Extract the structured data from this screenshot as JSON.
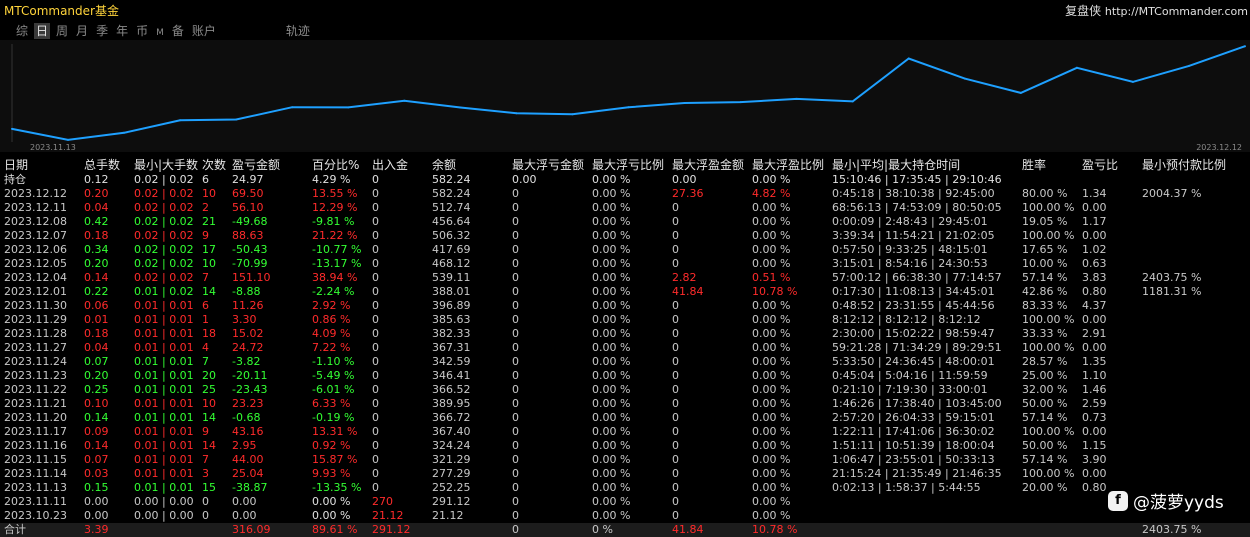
{
  "header": {
    "brand": "MTCommander",
    "brand_suffix": "基金",
    "top_label": "复盘侠",
    "url": "http://MTCommander.com"
  },
  "tabs": [
    "综",
    "日",
    "周",
    "月",
    "季",
    "年",
    "币",
    "M",
    "备",
    "账户",
    "轨迹"
  ],
  "active_tab": "日",
  "chart_data": {
    "type": "line",
    "x_start_label": "2023.11.13",
    "x_end_label": "2023.12.12",
    "x": [
      "2023.11.11",
      "2023.11.13",
      "2023.11.14",
      "2023.11.15",
      "2023.11.16",
      "2023.11.17",
      "2023.11.20",
      "2023.11.21",
      "2023.11.22",
      "2023.11.23",
      "2023.11.24",
      "2023.11.27",
      "2023.11.28",
      "2023.11.29",
      "2023.11.30",
      "2023.12.01",
      "2023.12.04",
      "2023.12.05",
      "2023.12.06",
      "2023.12.07",
      "2023.12.08",
      "2023.12.11",
      "2023.12.12"
    ],
    "values": [
      291.12,
      252.25,
      277.29,
      321.29,
      324.24,
      367.4,
      366.72,
      389.95,
      366.52,
      346.41,
      342.59,
      367.31,
      382.33,
      385.63,
      396.89,
      388.01,
      539.11,
      468.12,
      417.69,
      506.32,
      456.64,
      512.74,
      582.24
    ],
    "ylim": [
      245,
      590
    ],
    "color": "#1ea0ff"
  },
  "table": {
    "headers": [
      "日期",
      "总手数",
      "最小|大手数",
      "次数",
      "盈亏金额",
      "百分比%",
      "出入金",
      "余额",
      "最大浮亏金额",
      "最大浮亏比例",
      "最大浮盈金额",
      "最大浮盈比例",
      "最小|平均|最大持仓时间",
      "胜率",
      "盈亏比",
      "最小预付款比例"
    ],
    "hold": [
      "持仓",
      "0.12",
      "0.02 | 0.02",
      "6",
      "24.97",
      "4.29 %",
      "0",
      "582.24",
      "0.00",
      "0.00 %",
      "0.00",
      "0.00 %",
      "15:10:46 | 17:35:45 | 29:10:46",
      "",
      "",
      ""
    ],
    "rows": [
      {
        "c": "r",
        "v": [
          "2023.12.12",
          "0.20",
          "0.02 | 0.02",
          "10",
          "69.50",
          "13.55 %",
          "0",
          "582.24",
          "0",
          "0.00 %",
          "27.36",
          "4.82 %",
          "0:45:18 | 38:10:38 | 92:45:00",
          "80.00 %",
          "1.34",
          "2004.37 %"
        ]
      },
      {
        "c": "r",
        "v": [
          "2023.12.11",
          "0.04",
          "0.02 | 0.02",
          "2",
          "56.10",
          "12.29 %",
          "0",
          "512.74",
          "0",
          "0.00 %",
          "0",
          "0.00 %",
          "68:56:13 | 74:53:09 | 80:50:05",
          "100.00 %",
          "0.00",
          ""
        ]
      },
      {
        "c": "g",
        "v": [
          "2023.12.08",
          "0.42",
          "0.02 | 0.02",
          "21",
          "-49.68",
          "-9.81 %",
          "0",
          "456.64",
          "0",
          "0.00 %",
          "0",
          "0.00 %",
          "0:00:09 | 2:48:43 | 29:45:01",
          "19.05 %",
          "1.17",
          ""
        ]
      },
      {
        "c": "r",
        "v": [
          "2023.12.07",
          "0.18",
          "0.02 | 0.02",
          "9",
          "88.63",
          "21.22 %",
          "0",
          "506.32",
          "0",
          "0.00 %",
          "0",
          "0.00 %",
          "3:39:34 | 11:54:21 | 21:02:05",
          "100.00 %",
          "0.00",
          ""
        ]
      },
      {
        "c": "g",
        "v": [
          "2023.12.06",
          "0.34",
          "0.02 | 0.02",
          "17",
          "-50.43",
          "-10.77 %",
          "0",
          "417.69",
          "0",
          "0.00 %",
          "0",
          "0.00 %",
          "0:57:50 | 9:33:25 | 48:15:01",
          "17.65 %",
          "1.02",
          ""
        ]
      },
      {
        "c": "g",
        "v": [
          "2023.12.05",
          "0.20",
          "0.02 | 0.02",
          "10",
          "-70.99",
          "-13.17 %",
          "0",
          "468.12",
          "0",
          "0.00 %",
          "0",
          "0.00 %",
          "3:15:01 | 8:54:16 | 24:30:53",
          "10.00 %",
          "0.63",
          ""
        ]
      },
      {
        "c": "r",
        "v": [
          "2023.12.04",
          "0.14",
          "0.02 | 0.02",
          "7",
          "151.10",
          "38.94 %",
          "0",
          "539.11",
          "0",
          "0.00 %",
          "2.82",
          "0.51 %",
          "57:00:12 | 66:38:30 | 77:14:57",
          "57.14 %",
          "3.83",
          "2403.75 %"
        ]
      },
      {
        "c": "g",
        "v": [
          "2023.12.01",
          "0.22",
          "0.01 | 0.02",
          "14",
          "-8.88",
          "-2.24 %",
          "0",
          "388.01",
          "0",
          "0.00 %",
          "41.84",
          "10.78 %",
          "0:17:30 | 11:08:13 | 34:45:01",
          "42.86 %",
          "0.80",
          "1181.31 %"
        ]
      },
      {
        "c": "r",
        "v": [
          "2023.11.30",
          "0.06",
          "0.01 | 0.01",
          "6",
          "11.26",
          "2.92 %",
          "0",
          "396.89",
          "0",
          "0.00 %",
          "0",
          "0.00 %",
          "0:48:52 | 23:31:55 | 45:44:56",
          "83.33 %",
          "4.37",
          ""
        ]
      },
      {
        "c": "r",
        "v": [
          "2023.11.29",
          "0.01",
          "0.01 | 0.01",
          "1",
          "3.30",
          "0.86 %",
          "0",
          "385.63",
          "0",
          "0.00 %",
          "0",
          "0.00 %",
          "8:12:12 | 8:12:12 | 8:12:12",
          "100.00 %",
          "0.00",
          ""
        ]
      },
      {
        "c": "r",
        "v": [
          "2023.11.28",
          "0.18",
          "0.01 | 0.01",
          "18",
          "15.02",
          "4.09 %",
          "0",
          "382.33",
          "0",
          "0.00 %",
          "0",
          "0.00 %",
          "2:30:00 | 15:02:22 | 98:59:47",
          "33.33 %",
          "2.91",
          ""
        ]
      },
      {
        "c": "r",
        "v": [
          "2023.11.27",
          "0.04",
          "0.01 | 0.01",
          "4",
          "24.72",
          "7.22 %",
          "0",
          "367.31",
          "0",
          "0.00 %",
          "0",
          "0.00 %",
          "59:21:28 | 71:34:29 | 89:29:51",
          "100.00 %",
          "0.00",
          ""
        ]
      },
      {
        "c": "g",
        "v": [
          "2023.11.24",
          "0.07",
          "0.01 | 0.01",
          "7",
          "-3.82",
          "-1.10 %",
          "0",
          "342.59",
          "0",
          "0.00 %",
          "0",
          "0.00 %",
          "5:33:50 | 24:36:45 | 48:00:01",
          "28.57 %",
          "1.35",
          ""
        ]
      },
      {
        "c": "g",
        "v": [
          "2023.11.23",
          "0.20",
          "0.01 | 0.01",
          "20",
          "-20.11",
          "-5.49 %",
          "0",
          "346.41",
          "0",
          "0.00 %",
          "0",
          "0.00 %",
          "0:45:04 | 5:04:16 | 11:59:59",
          "25.00 %",
          "1.10",
          ""
        ]
      },
      {
        "c": "g",
        "v": [
          "2023.11.22",
          "0.25",
          "0.01 | 0.01",
          "25",
          "-23.43",
          "-6.01 %",
          "0",
          "366.52",
          "0",
          "0.00 %",
          "0",
          "0.00 %",
          "0:21:10 | 7:19:30 | 33:00:01",
          "32.00 %",
          "1.46",
          ""
        ]
      },
      {
        "c": "r",
        "v": [
          "2023.11.21",
          "0.10",
          "0.01 | 0.01",
          "10",
          "23.23",
          "6.33 %",
          "0",
          "389.95",
          "0",
          "0.00 %",
          "0",
          "0.00 %",
          "1:46:26 | 17:38:40 | 103:45:00",
          "50.00 %",
          "2.59",
          ""
        ]
      },
      {
        "c": "g",
        "v": [
          "2023.11.20",
          "0.14",
          "0.01 | 0.01",
          "14",
          "-0.68",
          "-0.19 %",
          "0",
          "366.72",
          "0",
          "0.00 %",
          "0",
          "0.00 %",
          "2:57:20 | 26:04:33 | 59:15:01",
          "57.14 %",
          "0.73",
          ""
        ]
      },
      {
        "c": "r",
        "v": [
          "2023.11.17",
          "0.09",
          "0.01 | 0.01",
          "9",
          "43.16",
          "13.31 %",
          "0",
          "367.40",
          "0",
          "0.00 %",
          "0",
          "0.00 %",
          "1:22:11 | 17:41:06 | 36:30:02",
          "100.00 %",
          "0.00",
          ""
        ]
      },
      {
        "c": "r",
        "v": [
          "2023.11.16",
          "0.14",
          "0.01 | 0.01",
          "14",
          "2.95",
          "0.92 %",
          "0",
          "324.24",
          "0",
          "0.00 %",
          "0",
          "0.00 %",
          "1:51:11 | 10:51:39 | 18:00:04",
          "50.00 %",
          "1.15",
          ""
        ]
      },
      {
        "c": "r",
        "v": [
          "2023.11.15",
          "0.07",
          "0.01 | 0.01",
          "7",
          "44.00",
          "15.87 %",
          "0",
          "321.29",
          "0",
          "0.00 %",
          "0",
          "0.00 %",
          "1:06:47 | 23:55:01 | 50:33:13",
          "57.14 %",
          "3.90",
          ""
        ]
      },
      {
        "c": "r",
        "v": [
          "2023.11.14",
          "0.03",
          "0.01 | 0.01",
          "3",
          "25.04",
          "9.93 %",
          "0",
          "277.29",
          "0",
          "0.00 %",
          "0",
          "0.00 %",
          "21:15:24 | 21:35:49 | 21:46:35",
          "100.00 %",
          "0.00",
          ""
        ]
      },
      {
        "c": "g",
        "v": [
          "2023.11.13",
          "0.15",
          "0.01 | 0.01",
          "15",
          "-38.87",
          "-13.35 %",
          "0",
          "252.25",
          "0",
          "0.00 %",
          "0",
          "0.00 %",
          "0:02:13 | 1:58:37 | 5:44:55",
          "20.00 %",
          "0.80",
          ""
        ]
      },
      {
        "c": "n",
        "v": [
          "2023.11.11",
          "0.00",
          "0.00 | 0.00",
          "0",
          "0.00",
          "0.00 %",
          "270",
          "291.12",
          "0",
          "0.00 %",
          "0",
          "0.00 %",
          "",
          "",
          "",
          ""
        ]
      },
      {
        "c": "n",
        "v": [
          "2023.10.23",
          "0.00",
          "0.00 | 0.00",
          "0",
          "0.00",
          "0.00 %",
          "21.12",
          "21.12",
          "0",
          "0.00 %",
          "0",
          "0.00 %",
          "",
          "",
          "",
          ""
        ]
      }
    ],
    "total": [
      "合计",
      "3.39",
      "",
      "",
      "316.09",
      "89.61 %",
      "291.12",
      "",
      "0",
      "0 %",
      "41.84",
      "10.78 %",
      "",
      "",
      "",
      "2403.75 %"
    ]
  },
  "watermark": {
    "icon": "f",
    "text": "@菠萝yyds"
  },
  "colors": {
    "profit": "#ff2b2b",
    "loss": "#33ff33",
    "line": "#1ea0ff",
    "brand": "#ffd43b"
  }
}
